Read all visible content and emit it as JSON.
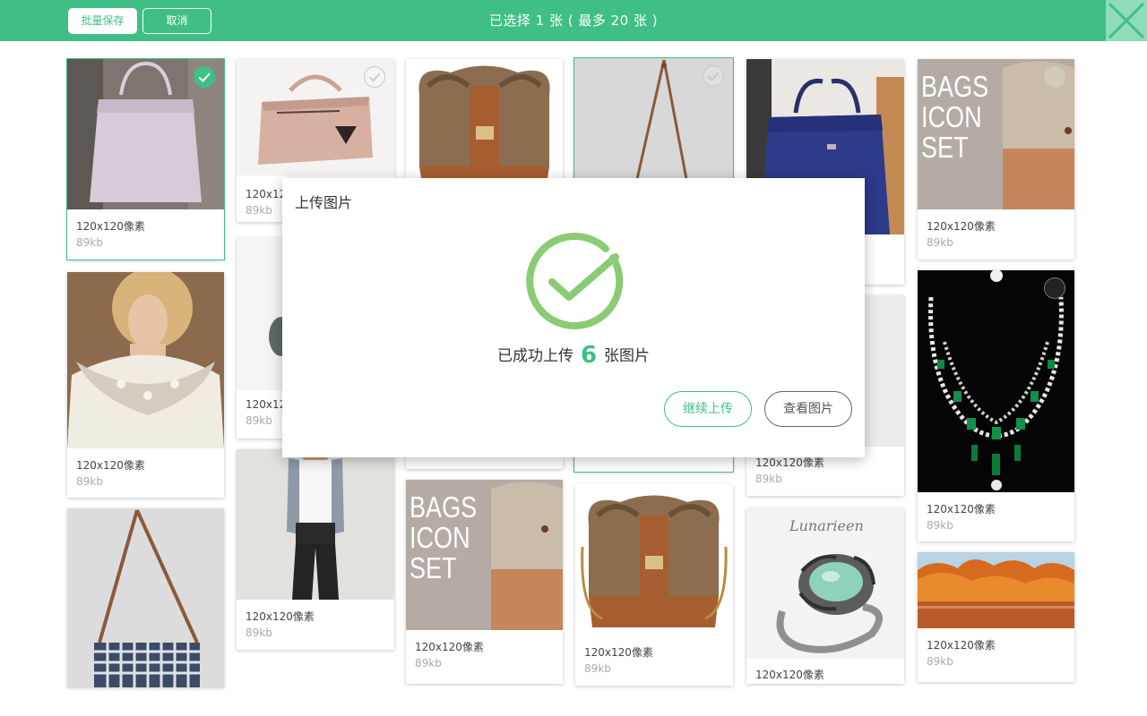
{
  "header": {
    "save_label": "批量保存",
    "cancel_label": "取消",
    "status": "已选择 1 张 ( 最多 20 张 )"
  },
  "colors": {
    "accent": "#3fbf85",
    "close_bg": "#8fdcb8"
  },
  "icons": {
    "close": "close-icon",
    "check": "check-icon",
    "success": "success-check-icon"
  },
  "cards": [
    {
      "dimensions": "120x120像素",
      "size": "89kb",
      "image": "white-handbag",
      "selected": true
    },
    {
      "dimensions": "120x12",
      "size": "89kb",
      "image": "pink-handbag",
      "selected": false
    },
    {
      "dimensions": "",
      "size": "",
      "image": "fur-bag",
      "selected": false
    },
    {
      "dimensions": "",
      "size": "",
      "image": "strap-bag",
      "selected": false
    },
    {
      "dimensions": "",
      "size": "",
      "image": "blue-handbag",
      "selected": false
    },
    {
      "dimensions": "120x120像素",
      "size": "89kb",
      "image": "bags-icon-set",
      "selected": false,
      "overlay_text": [
        "BAGS",
        "ICON",
        "SET"
      ]
    },
    {
      "dimensions": "120x120像素",
      "size": "89kb",
      "image": "jewelry-woman",
      "selected": false
    },
    {
      "dimensions": "120x12",
      "size": "89kb",
      "image": "ring-partial",
      "selected": false
    },
    {
      "dimensions": "120x120像素",
      "size": "89kb",
      "image": "white-bag",
      "selected": false
    },
    {
      "dimensions": "120x120像素",
      "size": "89kb",
      "image": "emerald-necklace",
      "selected": false
    },
    {
      "dimensions": "",
      "size": "",
      "image": "checkered-bag",
      "selected": false
    },
    {
      "dimensions": "120x120像素",
      "size": "89kb",
      "image": "woman-outfit",
      "selected": false
    },
    {
      "dimensions": "120x120像素",
      "size": "89kb",
      "image": "bags-icon-set",
      "selected": false,
      "overlay_text": [
        "BAGS",
        "ICON",
        "SET"
      ]
    },
    {
      "dimensions": "120x120像素",
      "size": "89kb",
      "image": "fur-bag",
      "selected": false
    },
    {
      "dimensions": "120x120像素",
      "size": "",
      "image": "green-ring",
      "selected": false,
      "overlay_text": [
        "Lunarieen"
      ]
    },
    {
      "dimensions": "120x120像素",
      "size": "89kb",
      "image": "autumn-trees",
      "selected": false
    }
  ],
  "modal": {
    "title": "上传图片",
    "message_prefix": "已成功上传",
    "count": "6",
    "message_suffix": "张图片",
    "continue_label": "继续上传",
    "view_label": "查看图片"
  }
}
